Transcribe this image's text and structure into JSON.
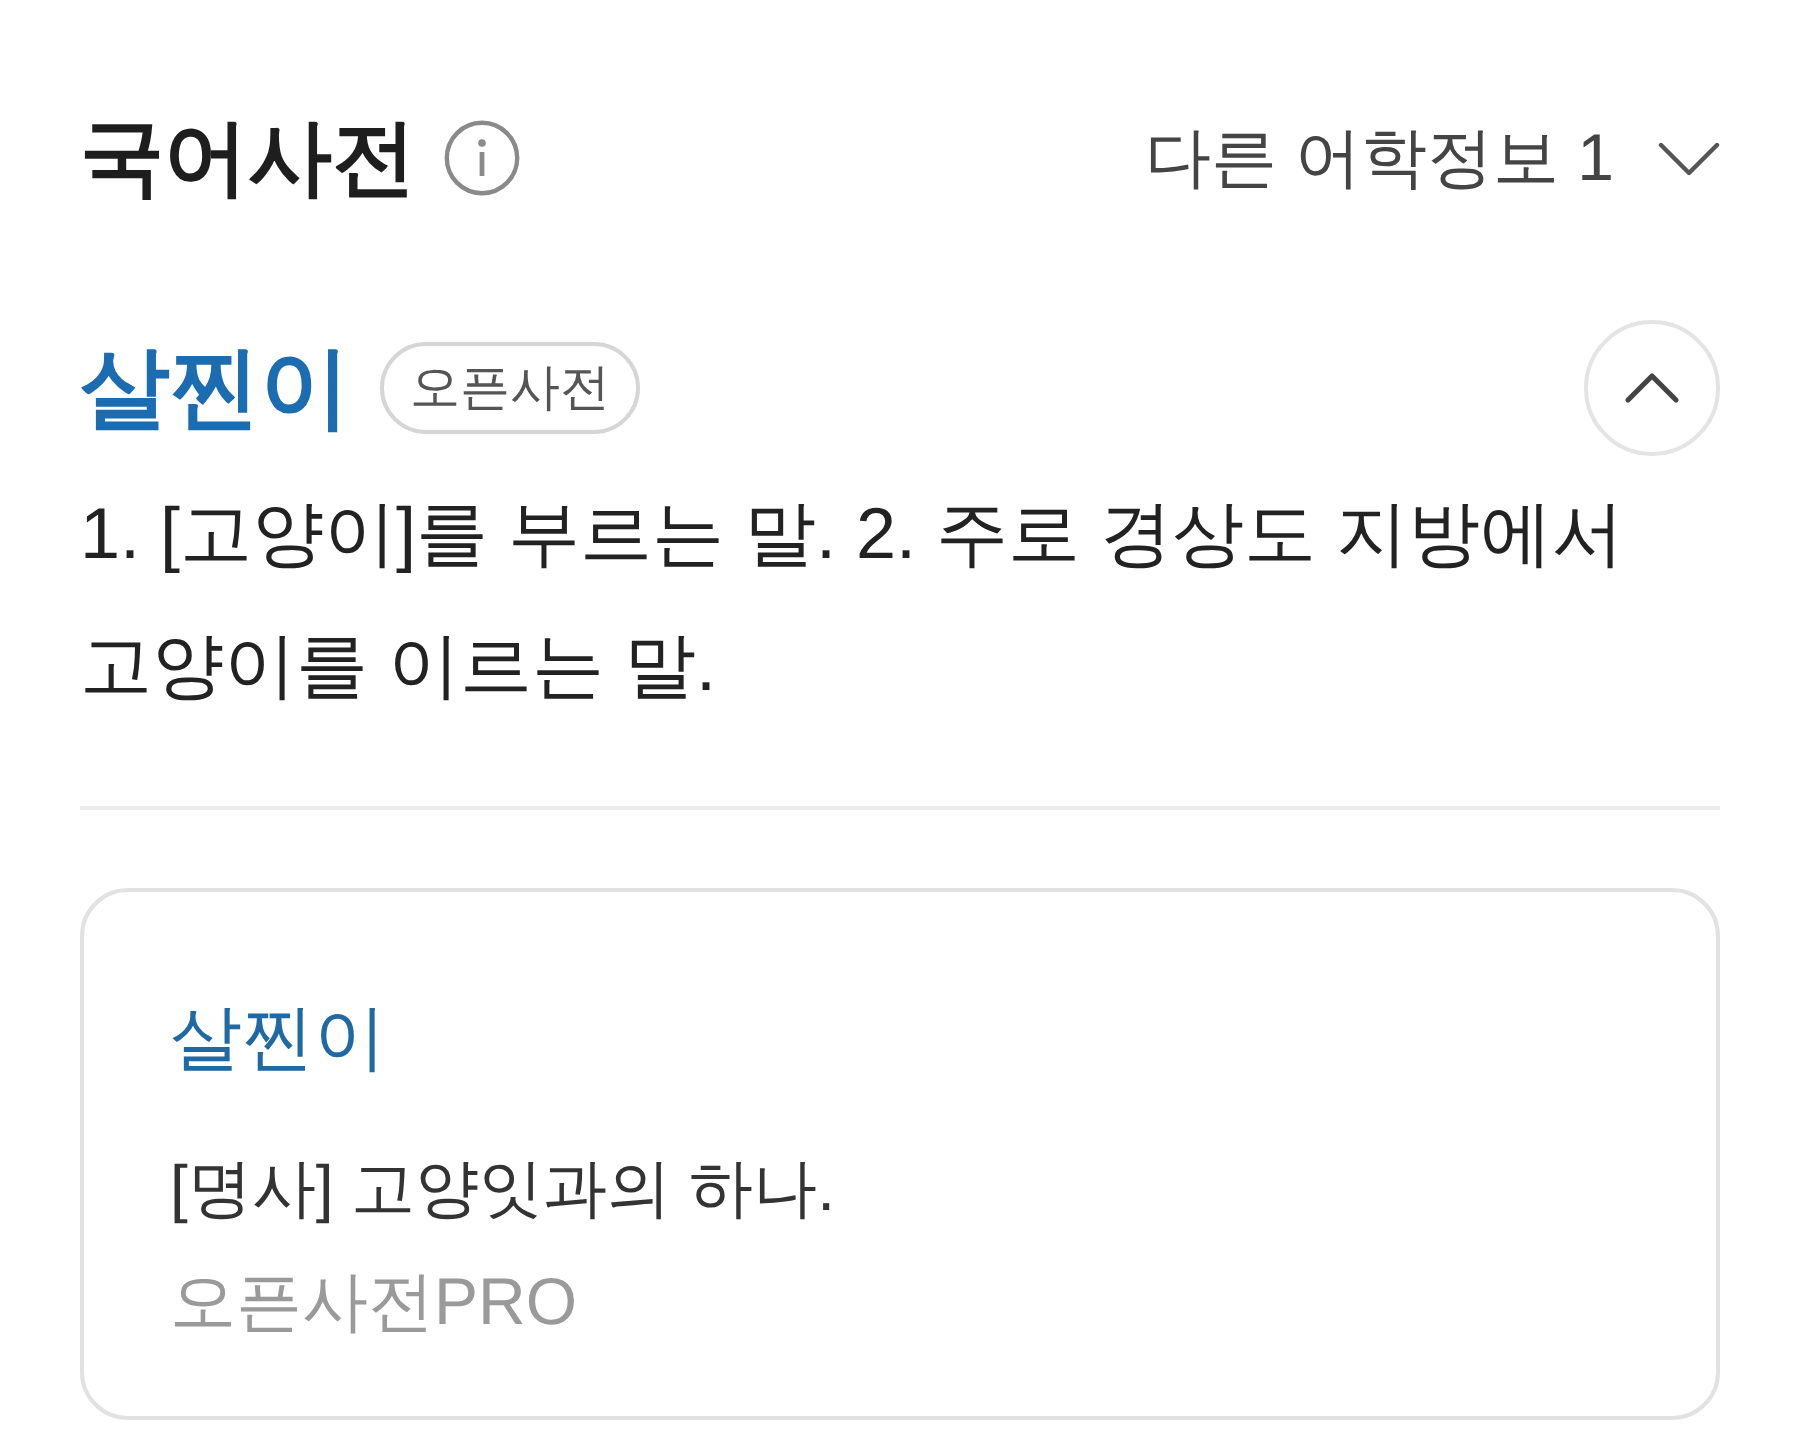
{
  "header": {
    "title": "국어사전",
    "other_info": {
      "label": "다른 어학정보 1",
      "expanded": false
    }
  },
  "entry": {
    "word": "살찐이",
    "source_badge": "오픈사전",
    "expanded": true,
    "definition": "1. [고양이]를 부르는 말. 2. 주로 경상도 지방에서 고양이를 이르는 말."
  },
  "card": {
    "word": "살찐이",
    "definition": "[명사] 고양잇과의 하나.",
    "source": "오픈사전PRO"
  }
}
